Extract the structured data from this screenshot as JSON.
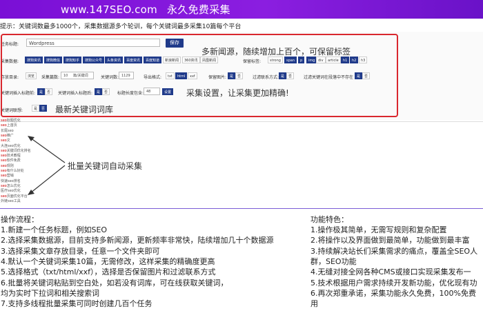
{
  "banner": {
    "site": "www.147SEO.com",
    "slogan": "永久免费采集"
  },
  "tip": "提示：关键词数最多1000个，采集数据源多个轮训，每个关键词最多采集10篇每个平台",
  "form": {
    "task_label": "任务标题:",
    "task_value": "Wordpress",
    "save_label": "保存",
    "source_label": "采集数据:",
    "sources": [
      {
        "label": "搜狗资讯",
        "on": true
      },
      {
        "label": "搜狗微信",
        "on": true
      },
      {
        "label": "搜狗知乎",
        "on": true
      },
      {
        "label": "搜狗公众号",
        "on": true
      },
      {
        "label": "头条资讯",
        "on": true
      },
      {
        "label": "百度资讯",
        "on": true
      },
      {
        "label": "百度知道",
        "on": true
      },
      {
        "label": "新浪新闻",
        "on": false
      },
      {
        "label": "360资讯",
        "on": false
      },
      {
        "label": "凤凰新闻",
        "on": false
      }
    ],
    "keep_tag_label": "保留标签:",
    "tags": [
      {
        "label": "strong",
        "on": false
      },
      {
        "label": "span",
        "on": true
      },
      {
        "label": "p",
        "on": true
      },
      {
        "label": "img",
        "on": true
      },
      {
        "label": "div",
        "on": false
      },
      {
        "label": "article",
        "on": false
      },
      {
        "label": "h1",
        "on": true
      },
      {
        "label": "h2",
        "on": true
      },
      {
        "label": "h3",
        "on": false
      }
    ],
    "row3": {
      "save_dir_label": "存放目录:",
      "save_dir_btn": "浏览",
      "count_label": "采集篇数:",
      "count_value": "10",
      "count_suffix": "篇/关键词",
      "kwcount_label": "关键词数:",
      "kwcount_value": "1129",
      "export_label": "导出格式:",
      "formats": [
        {
          "label": "txt",
          "on": false
        },
        {
          "label": "html",
          "on": true
        },
        {
          "label": "xxf",
          "on": false
        }
      ],
      "keep_img_label": "保留图片:",
      "keep_img_yes": "是",
      "keep_img_no": "否",
      "filter_contact_label": "过滤联系方式:",
      "filter_yes": "是",
      "filter_no": "否",
      "kw_exist_label": "过滤关键词在段落中不存在",
      "kw_yes": "是",
      "kw_no": "否"
    },
    "row4": {
      "title_ins_label": "关键词插入标题前:",
      "yes": "是",
      "no": "否",
      "kw_ins_label": "关键词插入标题后:",
      "title_len_label": "标题长度包含:",
      "title_len_value": "48",
      "set_label": "设置"
    },
    "row5": {
      "latest_label": "关键词联想:",
      "yes": "是",
      "no": "否"
    }
  },
  "annotations": {
    "a1": "多新闻源，随续增加上百个，可保留标签",
    "a2": "采集设置，让采集更加精确!",
    "a3": "最新关键词词库",
    "a4": "批量关键词自动采集"
  },
  "keywords": [
    {
      "hl": "seo",
      "rest": "标题优化"
    },
    {
      "hl": "seo",
      "rest": "上首页"
    },
    {
      "hl": "",
      "rest": "长尾seo"
    },
    {
      "hl": "seo",
      "rest": "推广"
    },
    {
      "hl": "seo",
      "rest": "文"
    },
    {
      "hl": "",
      "rest": "大连seo优化"
    },
    {
      "hl": "seo",
      "rest": "关键词优化排名"
    },
    {
      "hl": "seo",
      "rest": "技术教程"
    },
    {
      "hl": "seo",
      "rest": "软件免费"
    },
    {
      "hl": "seo",
      "rest": "规则"
    },
    {
      "hl": "seo",
      "rest": "有什么好处"
    },
    {
      "hl": "seo",
      "rest": "营销"
    },
    {
      "hl": "",
      "rest": "快速seo排名"
    },
    {
      "hl": "seo",
      "rest": "怎么优化"
    },
    {
      "hl": "",
      "rest": "医疗seo优化"
    },
    {
      "hl": "seo",
      "rest": "页面优化平台"
    },
    {
      "hl": "",
      "rest": "外链seo工具"
    }
  ],
  "left": {
    "title": "操作流程：",
    "lines": [
      "1.新建一个任务标题，例如SEO",
      "2.选择采集数据源，目前支持多新闻源，更新频率非常快，陆续增加几十个数据源",
      "3.选择采集文章存放目录，任意一个文件夹即可",
      "4.默认一个关键词采集10篇，无需修改，这样采集的精确度更高",
      "5.选择格式（txt/html/xxf），选择是否保留图片和过滤联系方式",
      "6.批量将关键词粘贴到空白处，如若没有词库，可在线获取关键词，",
      "均为实时下拉词和相关搜索词",
      "7.支持多线程批量采集可同时创建几百个任务"
    ]
  },
  "right": {
    "title": "功能特色：",
    "lines": [
      "1.操作极其简单，无需写规则和复杂配置",
      "2.将操作以及界面做到最简单，功能做到最丰富",
      "3.持续解决站长们采集需求的痛点，覆盖全SEO人",
      "群，SEO功能",
      "4.无缝对接全网各种CMS或接口实现采集发布一",
      "5.技术根据用户需求持续开发新功能，优化现有功",
      "6.再次郑重承诺，采集功能永久免费，100%免费",
      "用"
    ]
  }
}
